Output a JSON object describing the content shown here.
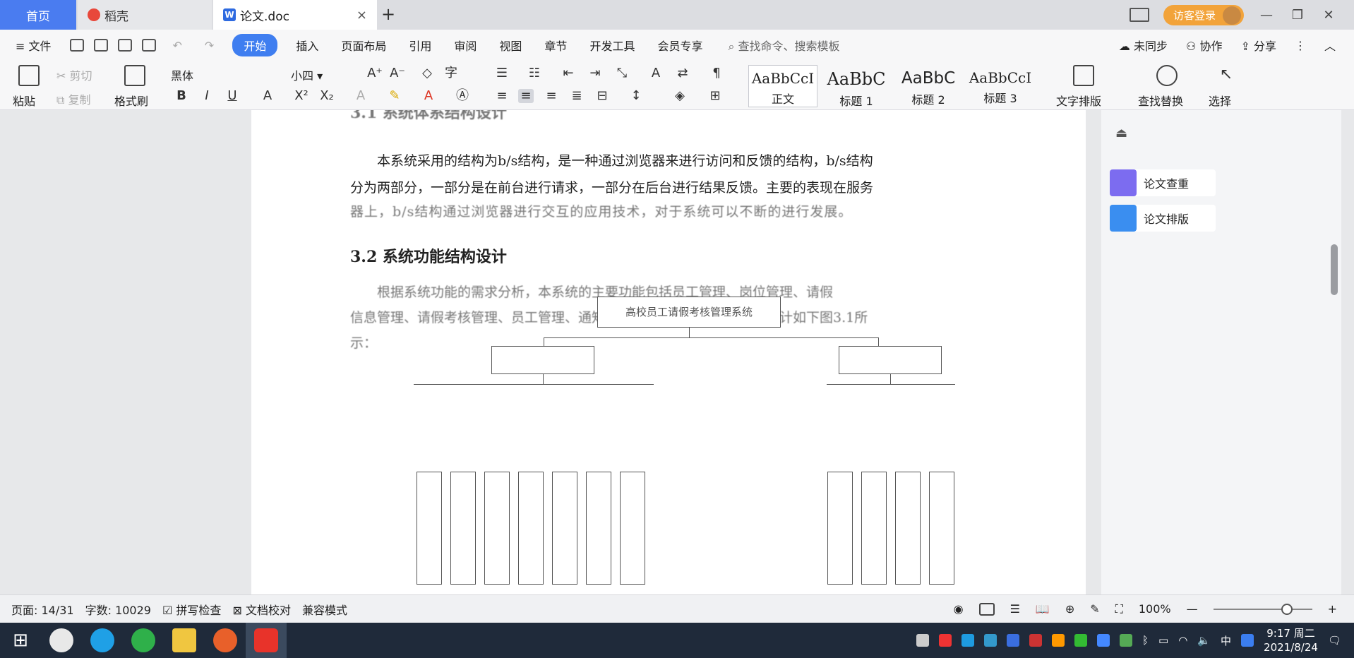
{
  "tabs": {
    "home": "首页",
    "docer": "稻壳",
    "doc": "论文.doc"
  },
  "login": "访客登录",
  "menu": {
    "file": "文件",
    "items": [
      "开始",
      "插入",
      "页面布局",
      "引用",
      "审阅",
      "视图",
      "章节",
      "开发工具",
      "会员专享"
    ],
    "search": "查找命令、搜索模板",
    "unsynced": "未同步",
    "collab": "协作",
    "share": "分享"
  },
  "ribbon": {
    "paste": "粘贴",
    "cut": "剪切",
    "copy": "复制",
    "format_painter": "格式刷",
    "font_name": "黑体",
    "font_size": "小四",
    "styles": [
      {
        "preview": "AaBbCcI",
        "label": "正文"
      },
      {
        "preview": "AaBbC",
        "label": "标题 1"
      },
      {
        "preview": "AaBbC",
        "label": "标题 2"
      },
      {
        "preview": "AaBbCcI",
        "label": "标题 3"
      }
    ],
    "text_layout": "文字排版",
    "find_replace": "查找替换",
    "select": "选择"
  },
  "document": {
    "p1_line1": "本系统采用的结构为b/s结构，是一种通过浏览器来进行访问和反馈的结构，b/s结构",
    "p1_line2": "分为两部分，一部分是在前台进行请求，一部分在后台进行结果反馈。主要的表现在服务",
    "heading": "3.2 系统功能结构设计",
    "diagram_title": "高校员工请假考核管理系统"
  },
  "sidepanel": {
    "check": "论文查重",
    "layout": "论文排版"
  },
  "status": {
    "page": "页面: 14/31",
    "words": "字数: 10029",
    "spell": "拼写检查",
    "proof": "文档校对",
    "compat": "兼容模式",
    "zoom": "100%"
  },
  "taskbar": {
    "time": "9:17 周二",
    "date": "2021/8/24",
    "ime": "中"
  }
}
